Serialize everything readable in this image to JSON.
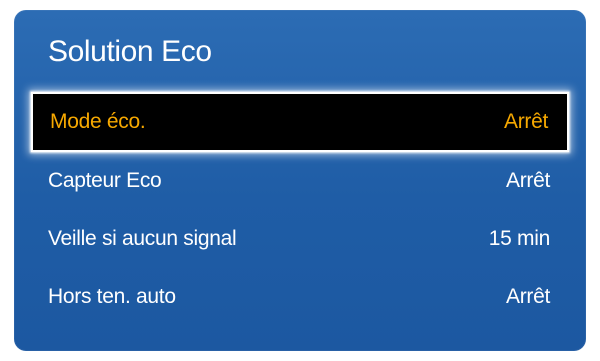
{
  "menu": {
    "title": "Solution Eco",
    "items": [
      {
        "label": "Mode éco.",
        "value": "Arrêt",
        "selected": true
      },
      {
        "label": "Capteur Eco",
        "value": "Arrêt",
        "selected": false
      },
      {
        "label": "Veille si aucun signal",
        "value": "15 min",
        "selected": false
      },
      {
        "label": "Hors ten. auto",
        "value": "Arrêt",
        "selected": false
      }
    ]
  },
  "colors": {
    "panel_blue": "#1f5da6",
    "highlight_text": "#f6a800",
    "highlight_background": "#000000",
    "text": "#ffffff"
  }
}
